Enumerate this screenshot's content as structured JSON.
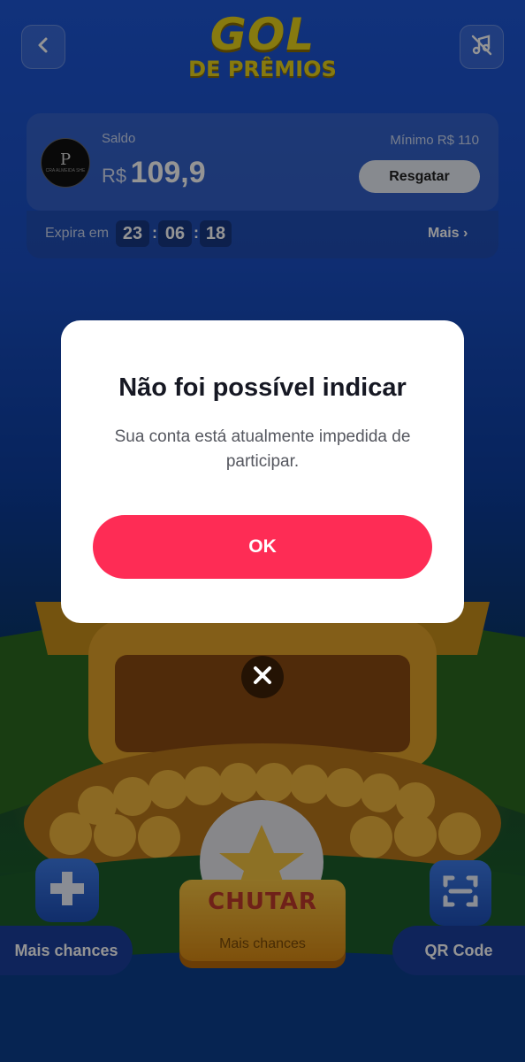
{
  "header": {
    "logo_top": "GOL",
    "logo_bottom": "DE PRÊMIOS"
  },
  "balance_card": {
    "avatar_monogram": "P",
    "avatar_subtext": "CRA ALMEIDA SHE",
    "saldo_label": "Saldo",
    "currency": "R$",
    "amount": "109,9",
    "minimum_label": "Mínimo  R$ 110",
    "redeem_label": "Resgatar",
    "expires_label": "Expira em",
    "timer": {
      "hours": "23",
      "minutes": "06",
      "seconds": "18"
    },
    "more_label": "Mais ›"
  },
  "bottom": {
    "left_label": "Mais chances",
    "kick_label": "CHUTAR",
    "kick_sub": "Mais chances",
    "right_label": "QR Code"
  },
  "modal": {
    "title": "Não foi possível indicar",
    "message": "Sua conta está atualmente impedida de participar.",
    "ok_label": "OK"
  },
  "colors": {
    "accent": "#fe2c55",
    "logo": "#e8d21a",
    "background": "#1a4fc4"
  },
  "icons": [
    "back-icon",
    "music-off-icon",
    "plus-icon",
    "qr-scan-icon",
    "close-icon"
  ]
}
